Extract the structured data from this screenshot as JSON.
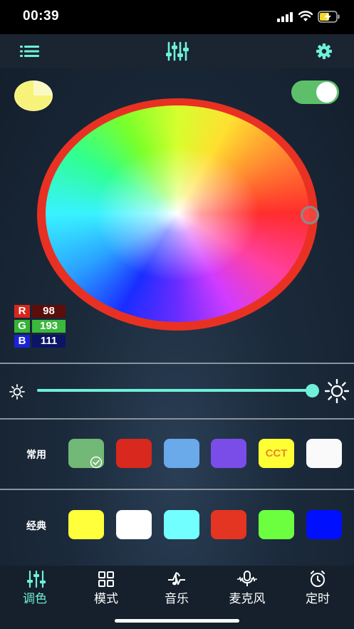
{
  "status_bar": {
    "time": "00:39"
  },
  "top_bar": {
    "menu_icon": "list-icon",
    "center_icon": "equalizer-sliders-icon",
    "settings_icon": "gear-icon"
  },
  "color_picker": {
    "preview_color": "#f7f27a",
    "power_on": true,
    "rgb": {
      "r_label": "R",
      "r_value": "98",
      "g_label": "G",
      "g_value": "193",
      "b_label": "B",
      "b_value": "111"
    }
  },
  "brightness": {
    "level": 1.0,
    "min_icon": "sun-small-icon",
    "max_icon": "sun-large-icon",
    "accent": "#6ff0d8"
  },
  "presets": {
    "common_label": "常用",
    "common": [
      {
        "color": "#72b876",
        "text": "",
        "selected": true
      },
      {
        "color": "#d9281e",
        "text": ""
      },
      {
        "color": "#6aa9ea",
        "text": ""
      },
      {
        "color": "#7a4ce8",
        "text": ""
      },
      {
        "color": "#ffff36",
        "text": "CCT"
      },
      {
        "color": "#fafafa",
        "text": ""
      }
    ],
    "classic_label": "经典",
    "classic": [
      {
        "color": "#ffff3c"
      },
      {
        "color": "#ffffff"
      },
      {
        "color": "#72ffff"
      },
      {
        "color": "#e43422"
      },
      {
        "color": "#6cff40"
      },
      {
        "color": "#0010ff"
      }
    ]
  },
  "bottom_nav": {
    "active_color": "#6ff0d8",
    "items": [
      {
        "label": "调色",
        "icon": "sliders-icon",
        "active": true
      },
      {
        "label": "模式",
        "icon": "grid-icon",
        "active": false
      },
      {
        "label": "音乐",
        "icon": "music-note-icon",
        "active": false
      },
      {
        "label": "麦克风",
        "icon": "microphone-icon",
        "active": false
      },
      {
        "label": "定时",
        "icon": "alarm-clock-icon",
        "active": false
      }
    ]
  }
}
